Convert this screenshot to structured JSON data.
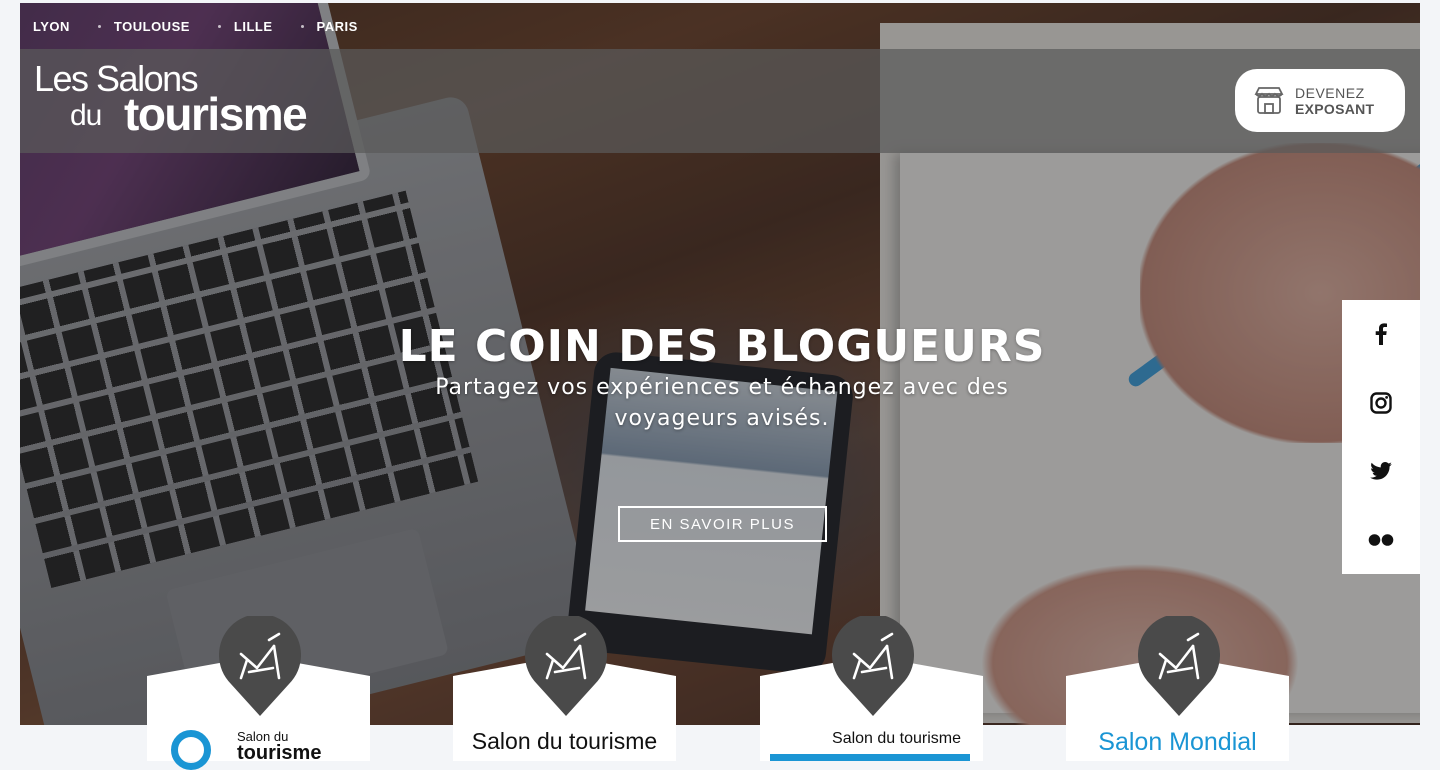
{
  "cities": [
    "LYON",
    "TOULOUSE",
    "LILLE",
    "PARIS"
  ],
  "logo": {
    "line1": "Les Salons",
    "line2": "du",
    "line3": "tourisme"
  },
  "exposant": {
    "line1": "DEVENEZ",
    "line2": "EXPOSANT"
  },
  "hero": {
    "title": "LE COIN DES BLOGUEURS",
    "subtitle": "Partagez vos expériences et échangez avec des voyageurs avisés.",
    "cta": "EN SAVOIR PLUS"
  },
  "social": [
    "facebook-icon",
    "instagram-icon",
    "twitter-icon",
    "flickr-icon"
  ],
  "cards": [
    {
      "small1": "Salon du",
      "small2": "tourisme",
      "accent": "#1a95d4"
    },
    {
      "small1": "Salon du tourisme",
      "accent": "#1a95d4"
    },
    {
      "small1": "Salon du tourisme",
      "accent": "#1a95d4"
    },
    {
      "small1": "Salon Mondial",
      "accent": "#1a95d4"
    }
  ],
  "colors": {
    "accent": "#1a95d4",
    "pin": "#4a4a4a",
    "header": "#5a5a5a"
  }
}
